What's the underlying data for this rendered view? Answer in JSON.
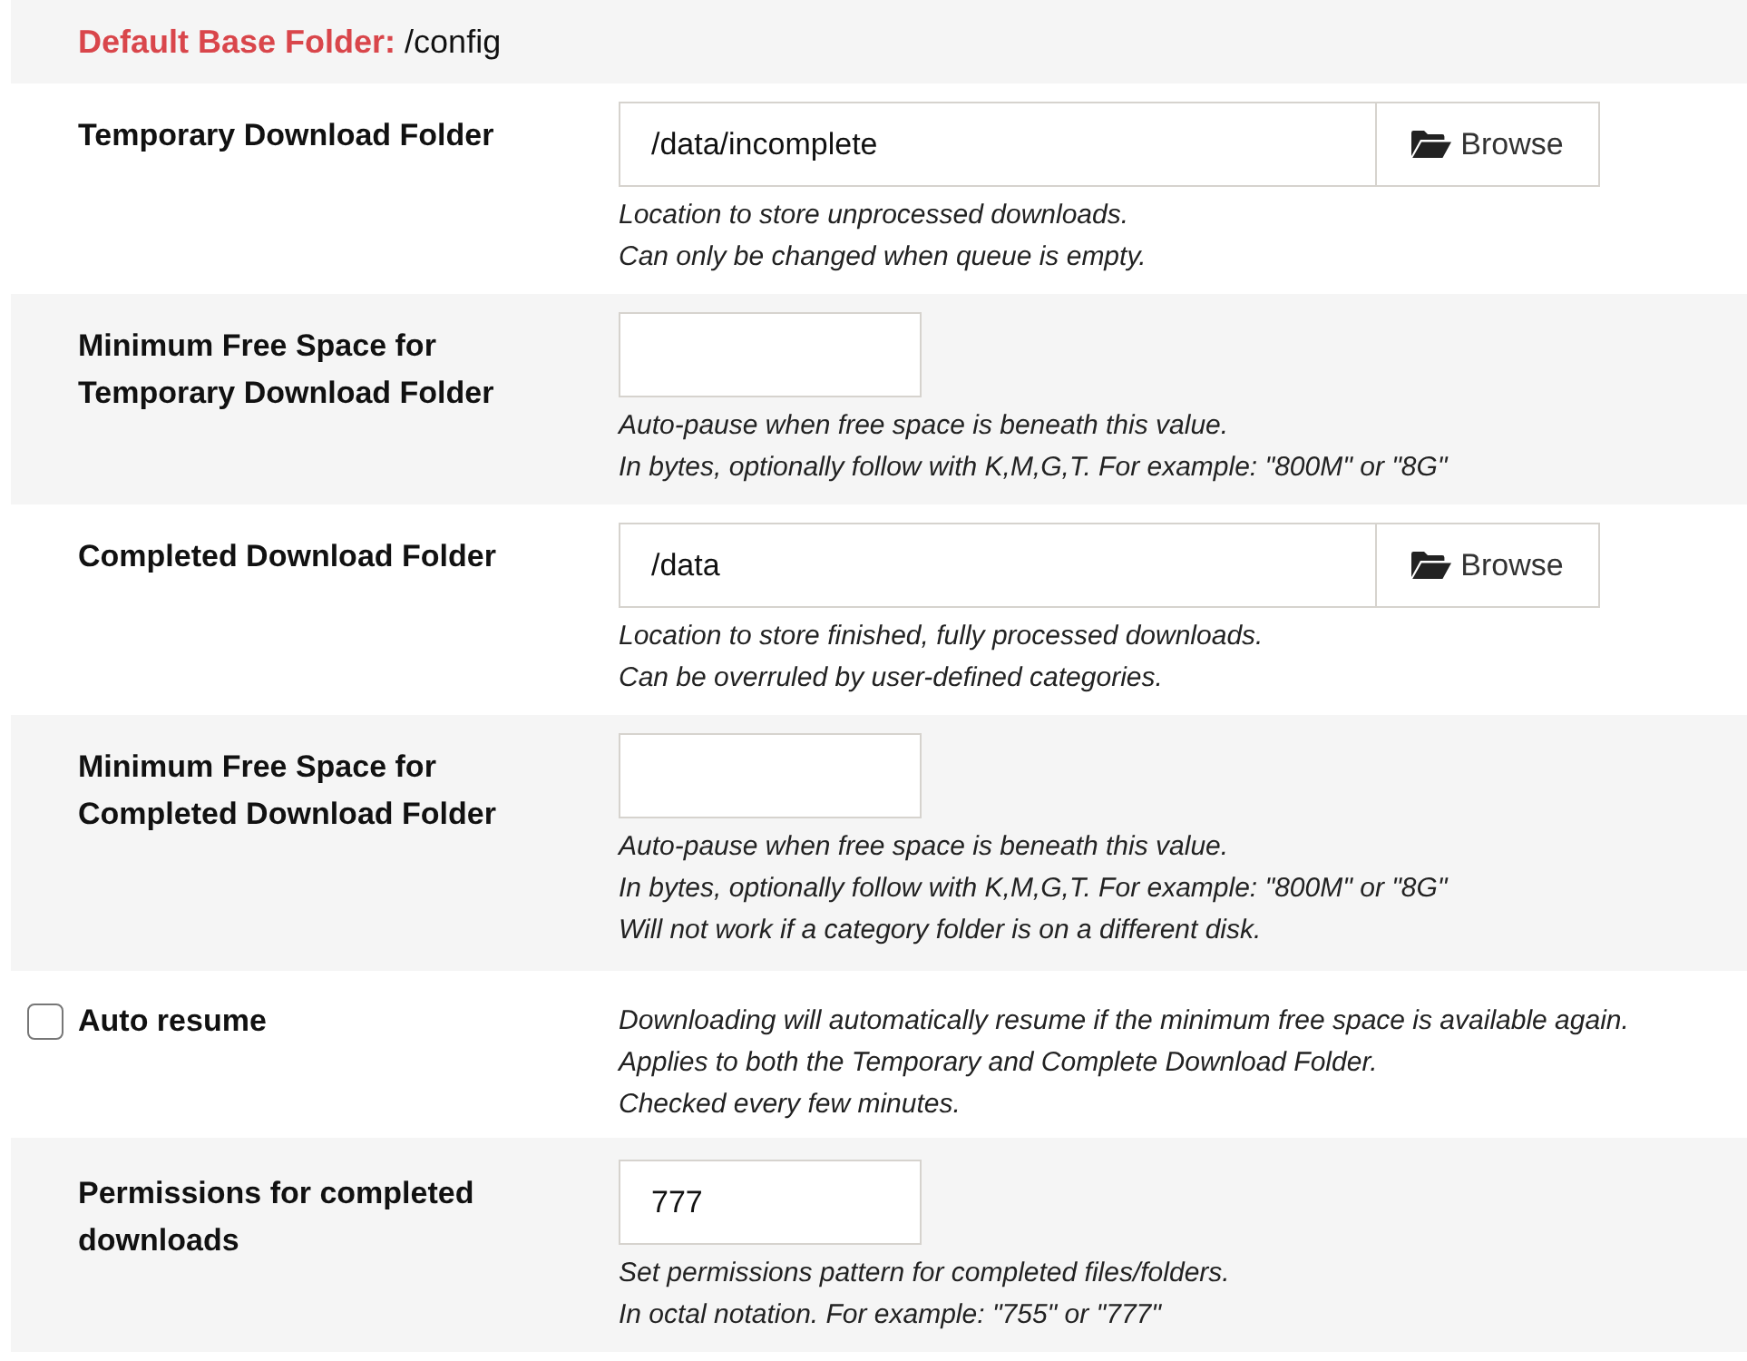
{
  "header": {
    "label": "Default Base Folder:",
    "value": "/config"
  },
  "rows": [
    {
      "kind": "folder",
      "label": "Temporary Download Folder",
      "value": "/data/incomplete",
      "button": "Browse",
      "help": [
        "Location to store unprocessed downloads.",
        "Can only be changed when queue is empty."
      ]
    },
    {
      "kind": "text",
      "label": "Minimum Free Space for Temporary Download Folder",
      "help": [
        "Auto-pause when free space is beneath this value.",
        "In bytes, optionally follow with K,M,G,T. For example: \"800M\" or \"8G\""
      ]
    },
    {
      "kind": "folder",
      "label": "Completed Download Folder",
      "value": "/data",
      "button": "Browse",
      "help": [
        "Location to store finished, fully processed downloads.",
        "Can be overruled by user-defined categories."
      ]
    },
    {
      "kind": "text",
      "label": "Minimum Free Space for Completed Download Folder",
      "help": [
        "Auto-pause when free space is beneath this value.",
        "In bytes, optionally follow with K,M,G,T. For example: \"800M\" or \"8G\"",
        "Will not work if a category folder is on a different disk."
      ]
    },
    {
      "kind": "checkbox",
      "label": "Auto resume",
      "checked": false,
      "help": [
        "Downloading will automatically resume if the minimum free space is available again.",
        "Applies to both the Temporary and Complete Download Folder.",
        "Checked every few minutes."
      ]
    },
    {
      "kind": "text",
      "label": "Permissions for completed downloads",
      "value": "777",
      "help": [
        "Set permissions pattern for completed files/folders.",
        "In octal notation. For example: \"755\" or \"777\""
      ]
    }
  ]
}
